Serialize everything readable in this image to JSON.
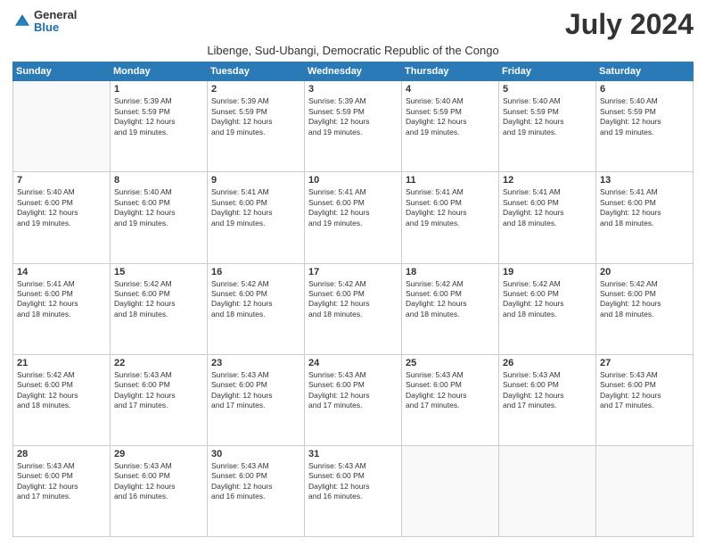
{
  "header": {
    "logo_general": "General",
    "logo_blue": "Blue",
    "month_year": "July 2024",
    "location": "Libenge, Sud-Ubangi, Democratic Republic of the Congo"
  },
  "days_of_week": [
    "Sunday",
    "Monday",
    "Tuesday",
    "Wednesday",
    "Thursday",
    "Friday",
    "Saturday"
  ],
  "weeks": [
    [
      {
        "day": "",
        "info": ""
      },
      {
        "day": "1",
        "info": "Sunrise: 5:39 AM\nSunset: 5:59 PM\nDaylight: 12 hours\nand 19 minutes."
      },
      {
        "day": "2",
        "info": "Sunrise: 5:39 AM\nSunset: 5:59 PM\nDaylight: 12 hours\nand 19 minutes."
      },
      {
        "day": "3",
        "info": "Sunrise: 5:39 AM\nSunset: 5:59 PM\nDaylight: 12 hours\nand 19 minutes."
      },
      {
        "day": "4",
        "info": "Sunrise: 5:40 AM\nSunset: 5:59 PM\nDaylight: 12 hours\nand 19 minutes."
      },
      {
        "day": "5",
        "info": "Sunrise: 5:40 AM\nSunset: 5:59 PM\nDaylight: 12 hours\nand 19 minutes."
      },
      {
        "day": "6",
        "info": "Sunrise: 5:40 AM\nSunset: 5:59 PM\nDaylight: 12 hours\nand 19 minutes."
      }
    ],
    [
      {
        "day": "7",
        "info": "Sunrise: 5:40 AM\nSunset: 6:00 PM\nDaylight: 12 hours\nand 19 minutes."
      },
      {
        "day": "8",
        "info": "Sunrise: 5:40 AM\nSunset: 6:00 PM\nDaylight: 12 hours\nand 19 minutes."
      },
      {
        "day": "9",
        "info": "Sunrise: 5:41 AM\nSunset: 6:00 PM\nDaylight: 12 hours\nand 19 minutes."
      },
      {
        "day": "10",
        "info": "Sunrise: 5:41 AM\nSunset: 6:00 PM\nDaylight: 12 hours\nand 19 minutes."
      },
      {
        "day": "11",
        "info": "Sunrise: 5:41 AM\nSunset: 6:00 PM\nDaylight: 12 hours\nand 19 minutes."
      },
      {
        "day": "12",
        "info": "Sunrise: 5:41 AM\nSunset: 6:00 PM\nDaylight: 12 hours\nand 18 minutes."
      },
      {
        "day": "13",
        "info": "Sunrise: 5:41 AM\nSunset: 6:00 PM\nDaylight: 12 hours\nand 18 minutes."
      }
    ],
    [
      {
        "day": "14",
        "info": "Sunrise: 5:41 AM\nSunset: 6:00 PM\nDaylight: 12 hours\nand 18 minutes."
      },
      {
        "day": "15",
        "info": "Sunrise: 5:42 AM\nSunset: 6:00 PM\nDaylight: 12 hours\nand 18 minutes."
      },
      {
        "day": "16",
        "info": "Sunrise: 5:42 AM\nSunset: 6:00 PM\nDaylight: 12 hours\nand 18 minutes."
      },
      {
        "day": "17",
        "info": "Sunrise: 5:42 AM\nSunset: 6:00 PM\nDaylight: 12 hours\nand 18 minutes."
      },
      {
        "day": "18",
        "info": "Sunrise: 5:42 AM\nSunset: 6:00 PM\nDaylight: 12 hours\nand 18 minutes."
      },
      {
        "day": "19",
        "info": "Sunrise: 5:42 AM\nSunset: 6:00 PM\nDaylight: 12 hours\nand 18 minutes."
      },
      {
        "day": "20",
        "info": "Sunrise: 5:42 AM\nSunset: 6:00 PM\nDaylight: 12 hours\nand 18 minutes."
      }
    ],
    [
      {
        "day": "21",
        "info": "Sunrise: 5:42 AM\nSunset: 6:00 PM\nDaylight: 12 hours\nand 18 minutes."
      },
      {
        "day": "22",
        "info": "Sunrise: 5:43 AM\nSunset: 6:00 PM\nDaylight: 12 hours\nand 17 minutes."
      },
      {
        "day": "23",
        "info": "Sunrise: 5:43 AM\nSunset: 6:00 PM\nDaylight: 12 hours\nand 17 minutes."
      },
      {
        "day": "24",
        "info": "Sunrise: 5:43 AM\nSunset: 6:00 PM\nDaylight: 12 hours\nand 17 minutes."
      },
      {
        "day": "25",
        "info": "Sunrise: 5:43 AM\nSunset: 6:00 PM\nDaylight: 12 hours\nand 17 minutes."
      },
      {
        "day": "26",
        "info": "Sunrise: 5:43 AM\nSunset: 6:00 PM\nDaylight: 12 hours\nand 17 minutes."
      },
      {
        "day": "27",
        "info": "Sunrise: 5:43 AM\nSunset: 6:00 PM\nDaylight: 12 hours\nand 17 minutes."
      }
    ],
    [
      {
        "day": "28",
        "info": "Sunrise: 5:43 AM\nSunset: 6:00 PM\nDaylight: 12 hours\nand 17 minutes."
      },
      {
        "day": "29",
        "info": "Sunrise: 5:43 AM\nSunset: 6:00 PM\nDaylight: 12 hours\nand 16 minutes."
      },
      {
        "day": "30",
        "info": "Sunrise: 5:43 AM\nSunset: 6:00 PM\nDaylight: 12 hours\nand 16 minutes."
      },
      {
        "day": "31",
        "info": "Sunrise: 5:43 AM\nSunset: 6:00 PM\nDaylight: 12 hours\nand 16 minutes."
      },
      {
        "day": "",
        "info": ""
      },
      {
        "day": "",
        "info": ""
      },
      {
        "day": "",
        "info": ""
      }
    ]
  ]
}
